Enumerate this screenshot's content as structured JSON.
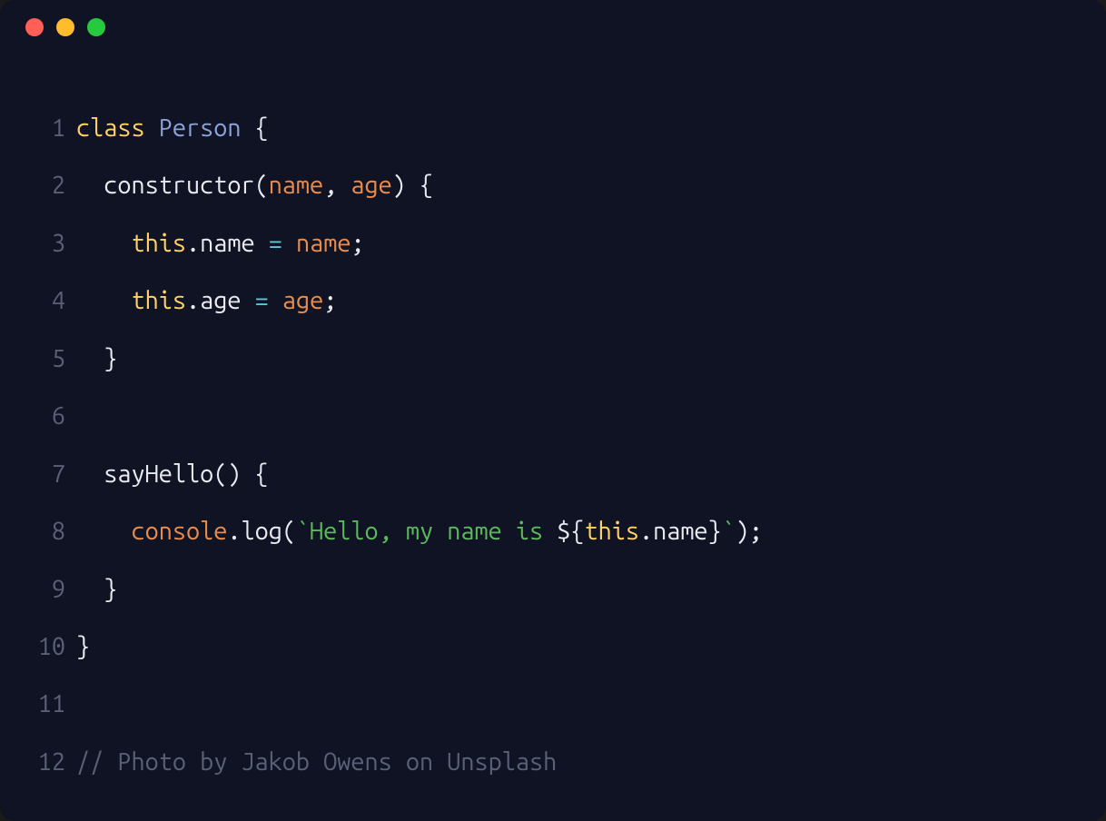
{
  "titlebar": {
    "close": "close",
    "min": "minimize",
    "max": "maximize"
  },
  "code": {
    "lines": [
      {
        "n": "1",
        "tokens": [
          {
            "c": "tok-keyword",
            "t": "class"
          },
          {
            "c": "tok-white",
            "t": " "
          },
          {
            "c": "tok-class",
            "t": "Person"
          },
          {
            "c": "tok-white",
            "t": " "
          },
          {
            "c": "tok-punc",
            "t": "{"
          }
        ]
      },
      {
        "n": "2",
        "tokens": [
          {
            "c": "tok-white",
            "t": "  constructor("
          },
          {
            "c": "tok-param",
            "t": "name"
          },
          {
            "c": "tok-white",
            "t": ", "
          },
          {
            "c": "tok-param",
            "t": "age"
          },
          {
            "c": "tok-white",
            "t": ") {"
          }
        ]
      },
      {
        "n": "3",
        "tokens": [
          {
            "c": "tok-white",
            "t": "    "
          },
          {
            "c": "tok-this",
            "t": "this"
          },
          {
            "c": "tok-white",
            "t": ".name "
          },
          {
            "c": "tok-op",
            "t": "="
          },
          {
            "c": "tok-white",
            "t": " "
          },
          {
            "c": "tok-param",
            "t": "name"
          },
          {
            "c": "tok-white",
            "t": ";"
          }
        ]
      },
      {
        "n": "4",
        "tokens": [
          {
            "c": "tok-white",
            "t": "    "
          },
          {
            "c": "tok-this",
            "t": "this"
          },
          {
            "c": "tok-white",
            "t": ".age "
          },
          {
            "c": "tok-op",
            "t": "="
          },
          {
            "c": "tok-white",
            "t": " "
          },
          {
            "c": "tok-param",
            "t": "age"
          },
          {
            "c": "tok-white",
            "t": ";"
          }
        ]
      },
      {
        "n": "5",
        "tokens": [
          {
            "c": "tok-white",
            "t": "  }"
          }
        ]
      },
      {
        "n": "6",
        "tokens": []
      },
      {
        "n": "7",
        "tokens": [
          {
            "c": "tok-white",
            "t": "  sayHello() {"
          }
        ]
      },
      {
        "n": "8",
        "tokens": [
          {
            "c": "tok-white",
            "t": "    "
          },
          {
            "c": "tok-console",
            "t": "console"
          },
          {
            "c": "tok-white",
            "t": ".log("
          },
          {
            "c": "tok-tmpl",
            "t": "`Hello, my name is "
          },
          {
            "c": "tok-interp",
            "t": "${"
          },
          {
            "c": "tok-this",
            "t": "this"
          },
          {
            "c": "tok-interp",
            "t": ".name}"
          },
          {
            "c": "tok-tmpl",
            "t": "`"
          },
          {
            "c": "tok-white",
            "t": ");"
          }
        ]
      },
      {
        "n": "9",
        "tokens": [
          {
            "c": "tok-white",
            "t": "  }"
          }
        ]
      },
      {
        "n": "10",
        "tokens": [
          {
            "c": "tok-white",
            "t": "}"
          }
        ]
      },
      {
        "n": "11",
        "tokens": []
      },
      {
        "n": "12",
        "tokens": [
          {
            "c": "tok-comment",
            "t": "// Photo by Jakob Owens on Unsplash"
          }
        ]
      }
    ]
  }
}
